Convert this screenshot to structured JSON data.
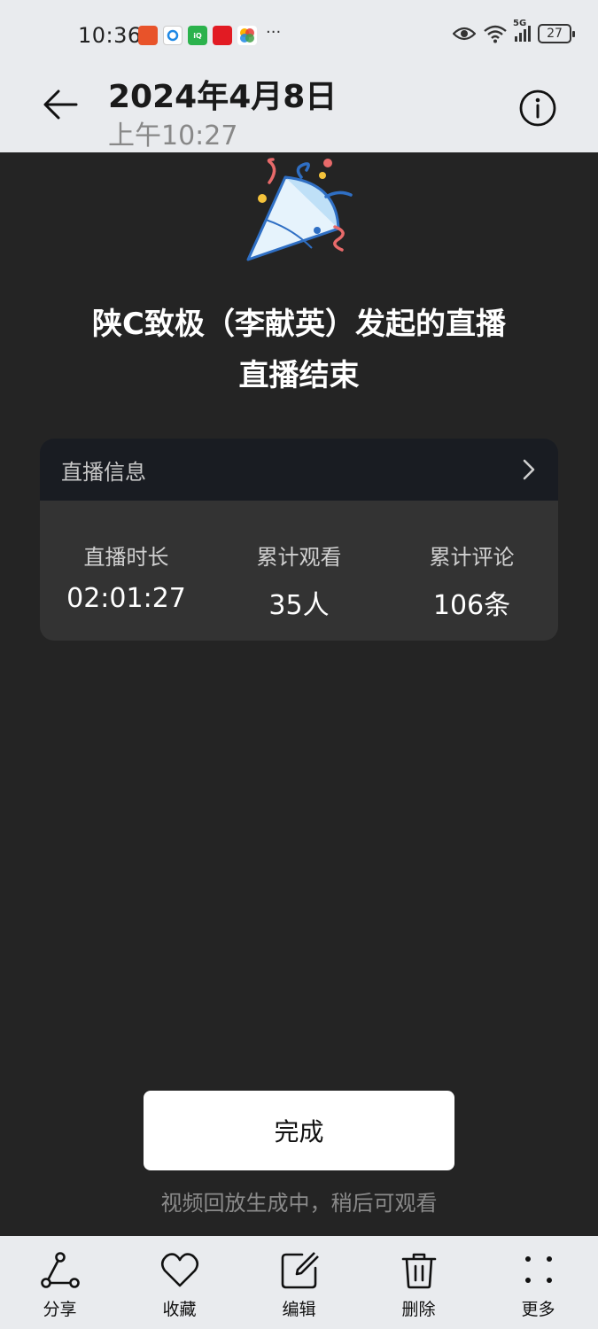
{
  "status_bar": {
    "time": "10:36",
    "more": "···",
    "network": "5G",
    "battery": "27"
  },
  "header": {
    "title": "2024年4月8日",
    "subtitle": "上午10:27"
  },
  "main": {
    "headline_1": "陕C致极（李献英）发起的直播",
    "headline_2": "直播结束",
    "card": {
      "title": "直播信息",
      "stats": [
        {
          "label": "直播时长",
          "value": "02:01:27"
        },
        {
          "label": "累计观看",
          "value": "35人"
        },
        {
          "label": "累计评论",
          "value": "106条"
        }
      ]
    },
    "done_label": "完成",
    "hint": "视频回放生成中，稍后可观看"
  },
  "toolbar": {
    "items": [
      {
        "label": "分享",
        "icon": "share-icon"
      },
      {
        "label": "收藏",
        "icon": "heart-icon"
      },
      {
        "label": "编辑",
        "icon": "edit-icon"
      },
      {
        "label": "删除",
        "icon": "trash-icon"
      },
      {
        "label": "更多",
        "icon": "more-icon"
      }
    ]
  }
}
